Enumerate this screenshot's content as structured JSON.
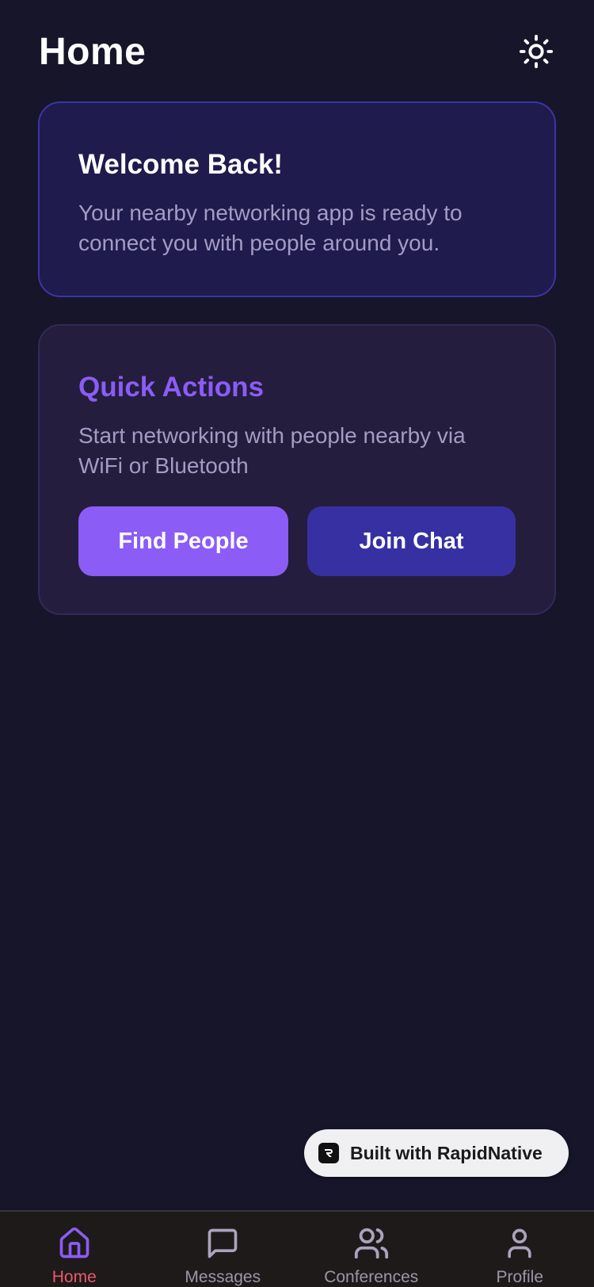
{
  "header": {
    "title": "Home",
    "theme_icon": "sun-icon"
  },
  "welcome": {
    "title": "Welcome Back!",
    "text": "Your nearby networking app is ready to connect you with people around you."
  },
  "quick_actions": {
    "title": "Quick Actions",
    "text": "Start networking with people nearby via WiFi or Bluetooth",
    "find_people_label": "Find People",
    "join_chat_label": "Join Chat"
  },
  "badge": {
    "text": "Built with RapidNative",
    "icon": "rapidnative-logo-icon"
  },
  "tabs": [
    {
      "label": "Home",
      "icon": "home-icon",
      "active": true
    },
    {
      "label": "Messages",
      "icon": "message-icon",
      "active": false
    },
    {
      "label": "Conferences",
      "icon": "users-icon",
      "active": false
    },
    {
      "label": "Profile",
      "icon": "user-icon",
      "active": false
    }
  ],
  "colors": {
    "background": "#17152a",
    "accent": "#8b5cf6",
    "secondary_button": "#3730a3",
    "active_tab_label": "#e85a6a",
    "muted_text": "#a49cc4"
  }
}
